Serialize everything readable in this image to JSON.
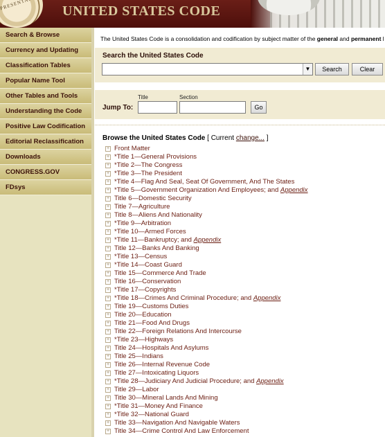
{
  "header": {
    "title": "UNITED STATES CODE",
    "seal_text": "REPRESENTATIVES"
  },
  "sidebar": {
    "items": [
      {
        "label": "Search & Browse"
      },
      {
        "label": "Currency and Updating"
      },
      {
        "label": "Classification Tables"
      },
      {
        "label": "Popular Name Tool"
      },
      {
        "label": "Other Tables and Tools"
      },
      {
        "label": "Understanding the Code"
      },
      {
        "label": "Positive Law Codification"
      },
      {
        "label": "Editorial Reclassification"
      },
      {
        "label": "Downloads"
      },
      {
        "label": "CONGRESS.GOV"
      },
      {
        "label": "FDsys"
      }
    ]
  },
  "intro": {
    "text_start": "The United States Code is a consolidation and codification by subject matter of the ",
    "bold1": "general",
    "text_mid": " and ",
    "bold2": "permanent",
    "text_end": " l"
  },
  "search": {
    "label": "Search the United States Code",
    "value": "",
    "search_button": "Search",
    "clear_button": "Clear"
  },
  "jump": {
    "label": "Jump To:",
    "title_caption": "Title",
    "section_caption": "Section",
    "title_value": "",
    "section_value": "",
    "go_button": "Go"
  },
  "browse": {
    "heading": "Browse the United States Code",
    "current_prefix": " [ Current ",
    "change_link": "change...",
    "current_suffix": " ]",
    "appendix_label": "Appendix",
    "expander_glyph": "+",
    "items": [
      {
        "text": "Front Matter",
        "appendix": false
      },
      {
        "text": "*Title 1—General Provisions",
        "appendix": false
      },
      {
        "text": "*Title 2—The Congress",
        "appendix": false
      },
      {
        "text": "*Title 3—The President",
        "appendix": false
      },
      {
        "text": "*Title 4—Flag And Seal, Seat Of Government, And The States",
        "appendix": false
      },
      {
        "text": "*Title 5—Government Organization And Employees; and ",
        "appendix": true
      },
      {
        "text": "Title 6—Domestic Security",
        "appendix": false
      },
      {
        "text": "Title 7—Agriculture",
        "appendix": false
      },
      {
        "text": "Title 8—Aliens And Nationality",
        "appendix": false
      },
      {
        "text": "*Title 9—Arbitration",
        "appendix": false
      },
      {
        "text": "*Title 10—Armed Forces",
        "appendix": false
      },
      {
        "text": "*Title 11—Bankruptcy; and ",
        "appendix": true
      },
      {
        "text": "Title 12—Banks And Banking",
        "appendix": false
      },
      {
        "text": "*Title 13—Census",
        "appendix": false
      },
      {
        "text": "*Title 14—Coast Guard",
        "appendix": false
      },
      {
        "text": "Title 15—Commerce And Trade",
        "appendix": false
      },
      {
        "text": "Title 16—Conservation",
        "appendix": false
      },
      {
        "text": "*Title 17—Copyrights",
        "appendix": false
      },
      {
        "text": "*Title 18—Crimes And Criminal Procedure; and ",
        "appendix": true
      },
      {
        "text": "Title 19—Customs Duties",
        "appendix": false
      },
      {
        "text": "Title 20—Education",
        "appendix": false
      },
      {
        "text": "Title 21—Food And Drugs",
        "appendix": false
      },
      {
        "text": "Title 22—Foreign Relations And Intercourse",
        "appendix": false
      },
      {
        "text": "*Title 23—Highways",
        "appendix": false
      },
      {
        "text": "Title 24—Hospitals And Asylums",
        "appendix": false
      },
      {
        "text": "Title 25—Indians",
        "appendix": false
      },
      {
        "text": "Title 26—Internal Revenue Code",
        "appendix": false
      },
      {
        "text": "Title 27—Intoxicating Liquors",
        "appendix": false
      },
      {
        "text": "*Title 28—Judiciary And Judicial Procedure; and ",
        "appendix": true
      },
      {
        "text": "Title 29—Labor",
        "appendix": false
      },
      {
        "text": "Title 30—Mineral Lands And Mining",
        "appendix": false
      },
      {
        "text": "*Title 31—Money And Finance",
        "appendix": false
      },
      {
        "text": "*Title 32—National Guard",
        "appendix": false
      },
      {
        "text": "Title 33—Navigation And Navigable Waters",
        "appendix": false
      },
      {
        "text": "Title 34—Crime Control And Law Enforcement",
        "appendix": false
      }
    ]
  },
  "colors": {
    "header_bg": "#5a1510",
    "header_text": "#d8c89c",
    "sidebar_bg": "#e7e3bf",
    "nav_text": "#3b1008",
    "panel_bg": "#f1ebd3",
    "link": "#6a1c10"
  }
}
